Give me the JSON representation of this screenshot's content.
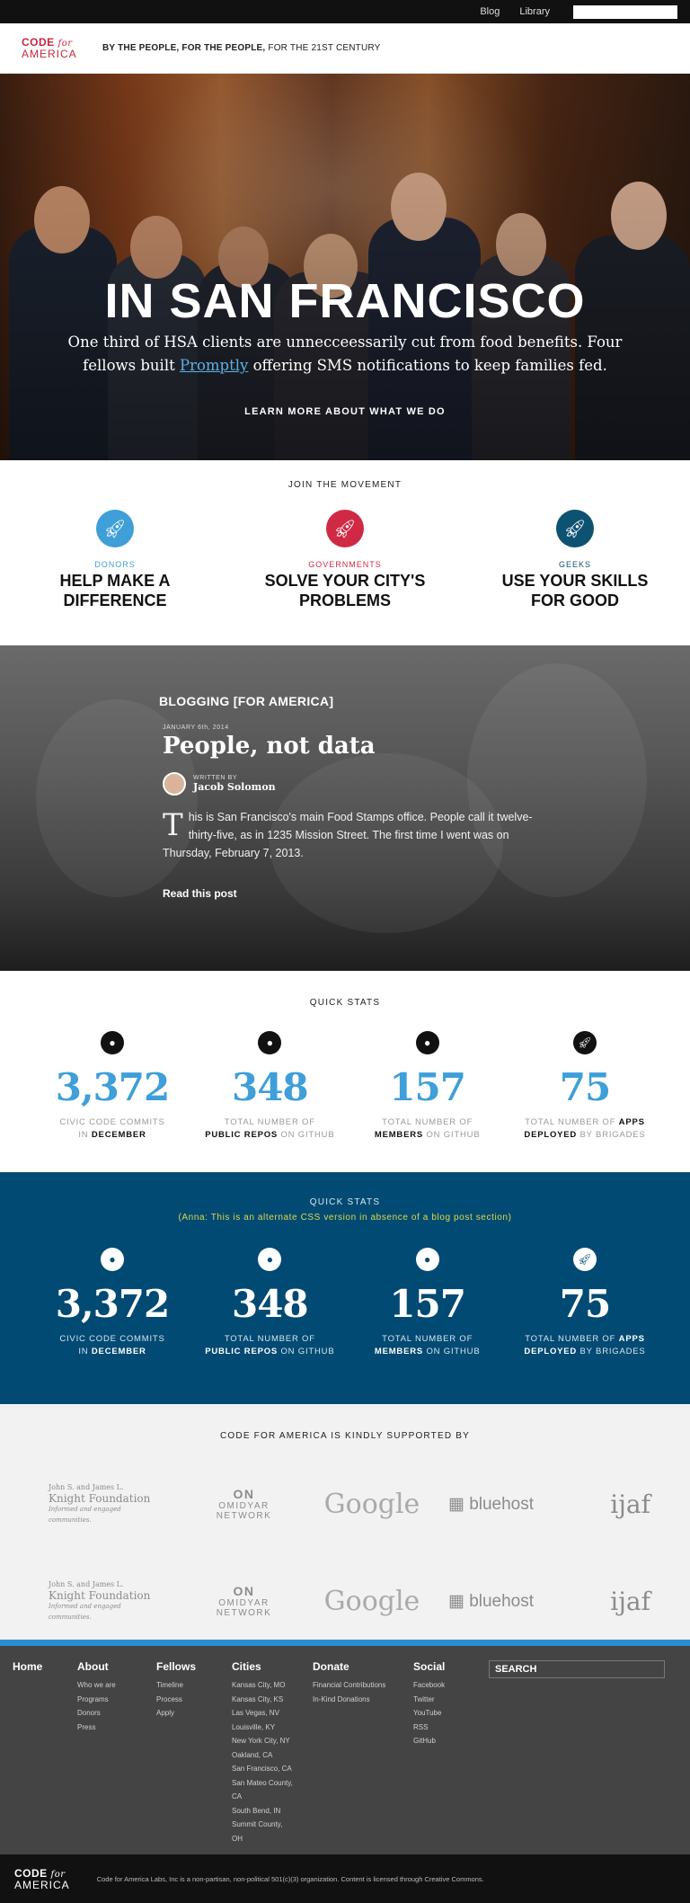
{
  "topbar": {
    "links": [
      "Blog",
      "Library"
    ],
    "search_placeholder": ""
  },
  "header": {
    "logo_line1": "CODE",
    "logo_for": "for",
    "logo_line2": "AMERICA",
    "tagline_bold": "BY THE PEOPLE, FOR THE PEOPLE,",
    "tagline_rest": " FOR THE 21ST CENTURY"
  },
  "hero": {
    "title": "IN SAN FRANCISCO",
    "text_before": "One third of HSA clients are unnecceessarily cut from food benefits. Four fellows built ",
    "link": "Promptly",
    "text_after": " offering SMS notifications to keep families fed.",
    "cta": "LEARN MORE ABOUT WHAT WE DO"
  },
  "join": {
    "label": "JOIN THE MOVEMENT",
    "items": [
      {
        "kind": "DONORS",
        "title1": "HELP MAKE A",
        "title2": "DIFFERENCE",
        "color": "#3e9fd9"
      },
      {
        "kind": "GOVERNMENTS",
        "title1": "SOLVE YOUR CITY'S",
        "title2": "PROBLEMS",
        "color": "#d02945"
      },
      {
        "kind": "GEEKS",
        "title1": "USE YOUR SKILLS",
        "title2": "FOR GOOD",
        "color": "#0e5272"
      }
    ]
  },
  "blog": {
    "heading": "BLOGGING [FOR AMERICA]",
    "date": "JANUARY 6th, 2014",
    "title": "People, not data",
    "written_by": "WRITTEN BY",
    "author": "Jacob Solomon",
    "dropcap": "T",
    "excerpt": "his is San Francisco's main Food Stamps office. People call it twelve-thirty-five, as in 1235 Mission Street. The first time I went was on Thursday, February 7, 2013.",
    "read_more": "Read this post"
  },
  "stats": {
    "label": "QUICK STATS",
    "items": [
      {
        "number": "3,372",
        "pre": "CIVIC CODE COMMITS",
        "line2pre": "IN ",
        "bold": "DECEMBER",
        "post": ""
      },
      {
        "number": "348",
        "pre": "TOTAL NUMBER OF",
        "line2pre": "",
        "bold": "PUBLIC REPOS",
        "post": " ON GITHUB"
      },
      {
        "number": "157",
        "pre": "TOTAL NUMBER OF",
        "line2pre": "",
        "bold": "MEMBERS",
        "post": " ON GITHUB"
      },
      {
        "number": "75",
        "pre": "TOTAL NUMBER OF ",
        "pre_bold": "APPS",
        "line2pre": "",
        "bold": "DEPLOYED",
        "post": " BY BRIGADES"
      }
    ]
  },
  "stats_alt": {
    "label": "QUICK STATS",
    "note": "(Anna: This is an alternate CSS version in absence of a blog post section)"
  },
  "supporters": {
    "label": "CODE FOR AMERICA IS KINDLY SUPPORTED BY",
    "knight_small": "John S. and James L.",
    "knight_big": "Knight Foundation",
    "knight_tag": "Informed and engaged communities.",
    "omidyar_mark": "ON",
    "omidyar": "OMIDYAR NETWORK",
    "google": "Google",
    "bluehost": "bluehost",
    "ijaf": "ijaf"
  },
  "footer": {
    "home": "Home",
    "about": {
      "title": "About",
      "links": [
        "Who we are",
        "Programs",
        "Donors",
        "Press"
      ]
    },
    "fellows": {
      "title": "Fellows",
      "links": [
        "Timeline",
        "Process",
        "Apply"
      ]
    },
    "cities": {
      "title": "Cities",
      "links": [
        "Kansas City, MO",
        "Kansas City, KS",
        "Las Vegas, NV",
        "Louisville, KY",
        "New York City, NY",
        "Oakland, CA",
        "San Francisco, CA",
        "San Mateo County, CA",
        "South Bend, IN",
        "Summit County, OH"
      ]
    },
    "donate": {
      "title": "Donate",
      "links": [
        "Financial Contributions",
        "In-Kind Donations"
      ]
    },
    "social": {
      "title": "Social",
      "links": [
        "Facebook",
        "Twitter",
        "YouTube",
        "RSS",
        "GitHub"
      ]
    },
    "search": "SEARCH",
    "legal": "Code for America Labs, Inc is a non-partisan, non-political 501(c)(3) organization. Content is licensed through Creative Commons."
  }
}
